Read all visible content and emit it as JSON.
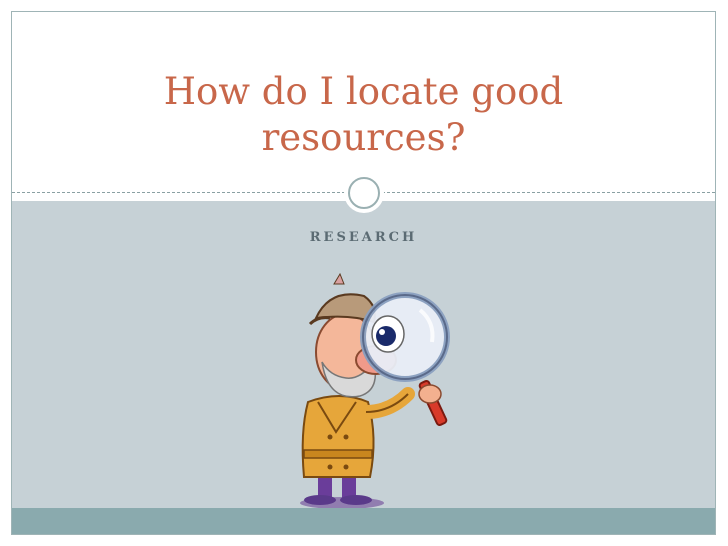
{
  "slide": {
    "title": "How do I locate good resources?",
    "subtitle": "RESEARCH"
  },
  "colors": {
    "title": "#c8674a",
    "subtitle": "#5b6b73",
    "content_band": "#c6d1d6",
    "footer_bar": "#8aaaae",
    "frame_border": "#9fb4b6"
  },
  "illustration": {
    "icon": "detective-with-magnifying-glass"
  }
}
